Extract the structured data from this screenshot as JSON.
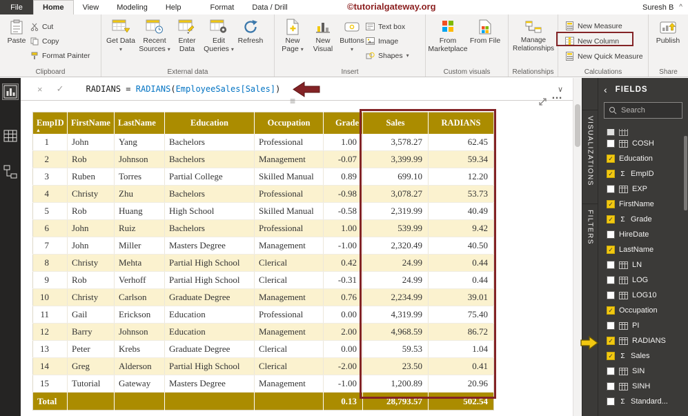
{
  "tabbar": {
    "file": "File",
    "tabs": [
      "Home",
      "View",
      "Modeling",
      "Help",
      "Format",
      "Data / Drill"
    ],
    "active_index": 0,
    "watermark": "©tutorialgateway.org",
    "user": "Suresh B"
  },
  "ribbon": {
    "clipboard": {
      "label": "Clipboard",
      "paste": "Paste",
      "cut": "Cut",
      "copy": "Copy",
      "format_painter": "Format Painter"
    },
    "external_data": {
      "label": "External data",
      "get_data": "Get Data",
      "recent_sources": "Recent Sources",
      "enter_data": "Enter Data",
      "edit_queries": "Edit Queries",
      "refresh": "Refresh"
    },
    "insert": {
      "label": "Insert",
      "new_page": "New Page",
      "new_visual": "New Visual",
      "buttons": "Buttons",
      "text_box": "Text box",
      "image": "Image",
      "shapes": "Shapes"
    },
    "custom_visuals": {
      "label": "Custom visuals",
      "from_marketplace": "From Marketplace",
      "from_file": "From File"
    },
    "relationships": {
      "label": "Relationships",
      "manage_relationships": "Manage Relationships"
    },
    "calculations": {
      "label": "Calculations",
      "new_measure": "New Measure",
      "new_column": "New Column",
      "new_quick_measure": "New Quick Measure"
    },
    "share": {
      "label": "Share",
      "publish": "Publish"
    }
  },
  "formula_bar": {
    "parts": [
      {
        "text": "RADIANS ",
        "color": "#1a1a1a"
      },
      {
        "text": "= ",
        "color": "#1a1a1a"
      },
      {
        "text": "RADIANS",
        "color": "#0273c3"
      },
      {
        "text": "(",
        "color": "#1a1a1a"
      },
      {
        "text": "EmployeeSales[Sales]",
        "color": "#0273c3"
      },
      {
        "text": ")",
        "color": "#1a1a1a"
      }
    ]
  },
  "table": {
    "headers": [
      "EmpID",
      "FirstName",
      "LastName",
      "Education",
      "Occupation",
      "Grade",
      "Sales",
      "RADIANS"
    ],
    "rows": [
      {
        "empid": "1",
        "first": "John",
        "last": "Yang",
        "edu": "Bachelors",
        "occ": "Professional",
        "grade": "1.00",
        "sales": "3,578.27",
        "radians": "62.45"
      },
      {
        "empid": "2",
        "first": "Rob",
        "last": "Johnson",
        "edu": "Bachelors",
        "occ": "Management",
        "grade": "-0.07",
        "sales": "3,399.99",
        "radians": "59.34"
      },
      {
        "empid": "3",
        "first": "Ruben",
        "last": "Torres",
        "edu": "Partial College",
        "occ": "Skilled Manual",
        "grade": "0.89",
        "sales": "699.10",
        "radians": "12.20"
      },
      {
        "empid": "4",
        "first": "Christy",
        "last": "Zhu",
        "edu": "Bachelors",
        "occ": "Professional",
        "grade": "-0.98",
        "sales": "3,078.27",
        "radians": "53.73"
      },
      {
        "empid": "5",
        "first": "Rob",
        "last": "Huang",
        "edu": "High School",
        "occ": "Skilled Manual",
        "grade": "-0.58",
        "sales": "2,319.99",
        "radians": "40.49"
      },
      {
        "empid": "6",
        "first": "John",
        "last": "Ruiz",
        "edu": "Bachelors",
        "occ": "Professional",
        "grade": "1.00",
        "sales": "539.99",
        "radians": "9.42"
      },
      {
        "empid": "7",
        "first": "John",
        "last": "Miller",
        "edu": "Masters Degree",
        "occ": "Management",
        "grade": "-1.00",
        "sales": "2,320.49",
        "radians": "40.50"
      },
      {
        "empid": "8",
        "first": "Christy",
        "last": "Mehta",
        "edu": "Partial High School",
        "occ": "Clerical",
        "grade": "0.42",
        "sales": "24.99",
        "radians": "0.44"
      },
      {
        "empid": "9",
        "first": "Rob",
        "last": "Verhoff",
        "edu": "Partial High School",
        "occ": "Clerical",
        "grade": "-0.31",
        "sales": "24.99",
        "radians": "0.44"
      },
      {
        "empid": "10",
        "first": "Christy",
        "last": "Carlson",
        "edu": "Graduate Degree",
        "occ": "Management",
        "grade": "0.76",
        "sales": "2,234.99",
        "radians": "39.01"
      },
      {
        "empid": "11",
        "first": "Gail",
        "last": "Erickson",
        "edu": "Education",
        "occ": "Professional",
        "grade": "0.00",
        "sales": "4,319.99",
        "radians": "75.40"
      },
      {
        "empid": "12",
        "first": "Barry",
        "last": "Johnson",
        "edu": "Education",
        "occ": "Management",
        "grade": "2.00",
        "sales": "4,968.59",
        "radians": "86.72"
      },
      {
        "empid": "13",
        "first": "Peter",
        "last": "Krebs",
        "edu": "Graduate Degree",
        "occ": "Clerical",
        "grade": "0.00",
        "sales": "59.53",
        "radians": "1.04"
      },
      {
        "empid": "14",
        "first": "Greg",
        "last": "Alderson",
        "edu": "Partial High School",
        "occ": "Clerical",
        "grade": "-2.00",
        "sales": "23.50",
        "radians": "0.41"
      },
      {
        "empid": "15",
        "first": "Tutorial",
        "last": "Gateway",
        "edu": "Masters Degree",
        "occ": "Management",
        "grade": "-1.00",
        "sales": "1,200.89",
        "radians": "20.96"
      }
    ],
    "total": {
      "label": "Total",
      "grade": "0.13",
      "sales": "28,793.57",
      "radians": "502.54"
    }
  },
  "strips": {
    "visualizations": "VISUALIZATIONS",
    "filters": "FILTERS"
  },
  "fields": {
    "title": "FIELDS",
    "search_placeholder": "Search",
    "items": [
      {
        "name": "",
        "checked": false,
        "icon": "calc",
        "partial": true
      },
      {
        "name": "COSH",
        "checked": false,
        "icon": "calc"
      },
      {
        "name": "Education",
        "checked": true,
        "icon": "none"
      },
      {
        "name": "EmpID",
        "checked": true,
        "icon": "sigma"
      },
      {
        "name": "EXP",
        "checked": false,
        "icon": "calc"
      },
      {
        "name": "FirstName",
        "checked": true,
        "icon": "none"
      },
      {
        "name": "Grade",
        "checked": true,
        "icon": "sigma"
      },
      {
        "name": "HireDate",
        "checked": false,
        "icon": "none"
      },
      {
        "name": "LastName",
        "checked": true,
        "icon": "none"
      },
      {
        "name": "LN",
        "checked": false,
        "icon": "calc"
      },
      {
        "name": "LOG",
        "checked": false,
        "icon": "calc"
      },
      {
        "name": "LOG10",
        "checked": false,
        "icon": "calc"
      },
      {
        "name": "Occupation",
        "checked": true,
        "icon": "none"
      },
      {
        "name": "PI",
        "checked": false,
        "icon": "calc"
      },
      {
        "name": "RADIANS",
        "checked": true,
        "icon": "calc"
      },
      {
        "name": "Sales",
        "checked": true,
        "icon": "sigma"
      },
      {
        "name": "SIN",
        "checked": false,
        "icon": "calc"
      },
      {
        "name": "SINH",
        "checked": false,
        "icon": "calc"
      },
      {
        "name": "Standard...",
        "checked": false,
        "icon": "sigma"
      }
    ]
  },
  "icons": {
    "caret_down": "▾",
    "chevron_down": "∨",
    "chevron_up": "^",
    "cancel": "×",
    "check": "✓",
    "sigma": "Σ",
    "sort_asc": "▲",
    "collapse": "‹",
    "drag_handle": "≡",
    "ellipsis": "…"
  },
  "colors": {
    "accent_yellow": "#f2c811",
    "table_header_olive": "#ab8c00",
    "table_alt_row": "#fbf2cf",
    "annotation_red": "#832326",
    "watermark_red": "#8b1f1f"
  }
}
